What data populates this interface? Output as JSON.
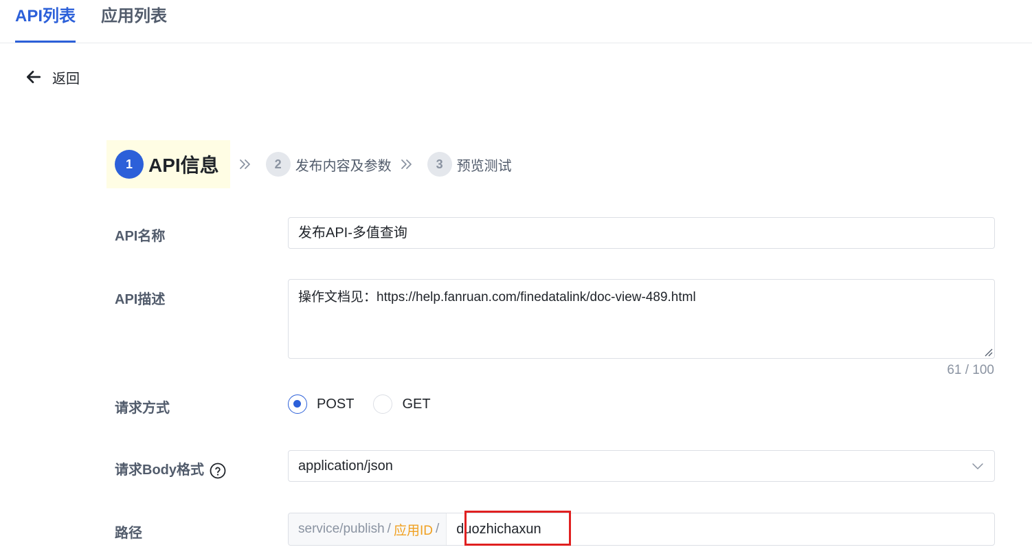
{
  "tabs": [
    {
      "label": "API列表",
      "active": true
    },
    {
      "label": "应用列表",
      "active": false
    }
  ],
  "back": {
    "label": "返回"
  },
  "steps": [
    {
      "num": "1",
      "label": "API信息",
      "active": true
    },
    {
      "num": "2",
      "label": "发布内容及参数",
      "active": false
    },
    {
      "num": "3",
      "label": "预览测试",
      "active": false
    }
  ],
  "form": {
    "api_name": {
      "label": "API名称",
      "value": "发布API-多值查询"
    },
    "api_desc": {
      "label": "API描述",
      "value": "操作文档见：https://help.fanruan.com/finedatalink/doc-view-489.html",
      "counter": "61 / 100"
    },
    "method": {
      "label": "请求方式",
      "options": [
        "POST",
        "GET"
      ],
      "selected": "POST"
    },
    "body_format": {
      "label": "请求Body格式",
      "value": "application/json"
    },
    "path": {
      "label": "路径",
      "prefix_1": "service/publish",
      "sep": "/",
      "app_id": "应用ID",
      "value": "duozhichaxun"
    }
  },
  "colors": {
    "accent": "#2c60d9",
    "highlight": "#e02020",
    "app_id": "#f0a020"
  }
}
